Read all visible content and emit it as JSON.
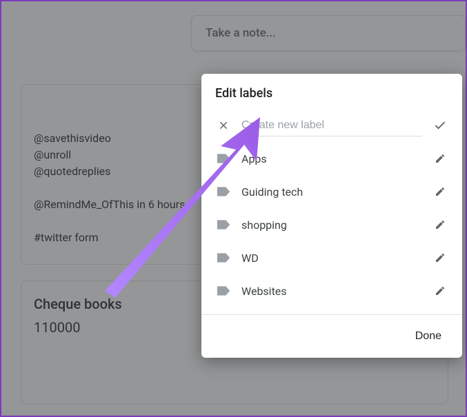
{
  "noteInput": {
    "placeholder": "Take a note..."
  },
  "notes": {
    "card1": "@savethisvideo\n@unroll\n@quotedreplies\n\n@RemindMe_OfThis in 6 hours\n\n#twitter form",
    "card2": {
      "title": "Cheque books",
      "body": "110000"
    }
  },
  "dialog": {
    "title": "Edit labels",
    "createPlaceholder": "Create new label",
    "labels": {
      "0": "Apps",
      "1": "Guiding tech",
      "2": "shopping",
      "3": "WD",
      "4": "Websites"
    },
    "done": "Done"
  }
}
